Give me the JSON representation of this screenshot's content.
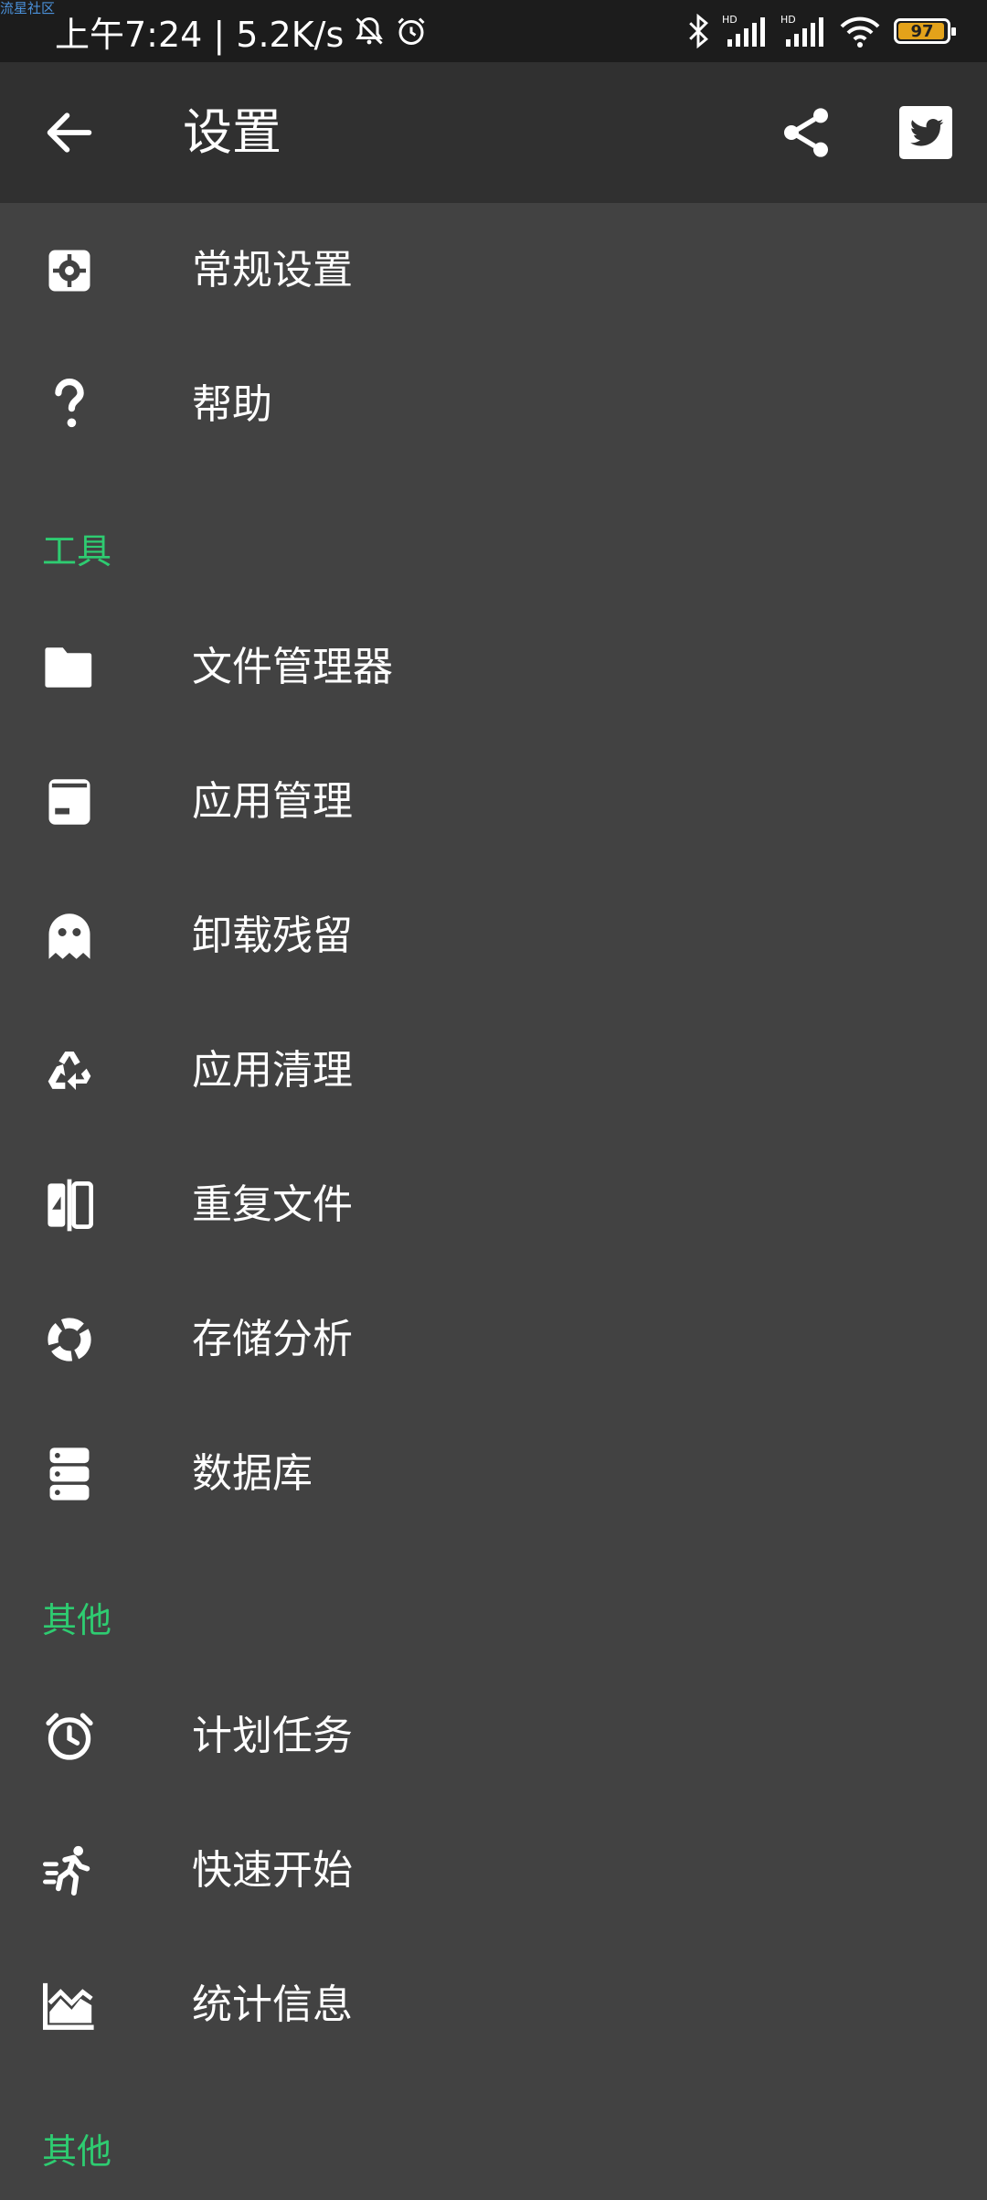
{
  "statusbar": {
    "watermark": "流星社区",
    "time_text": "上午7:24 | 5.2K/s",
    "battery": "97",
    "battery_level": 0.97
  },
  "appbar": {
    "title": "设置"
  },
  "items": {
    "general": "常规设置",
    "help": "帮助",
    "file_manager": "文件管理器",
    "app_manager": "应用管理",
    "leftovers": "卸载残留",
    "app_cleaner": "应用清理",
    "duplicates": "重复文件",
    "storage": "存储分析",
    "database": "数据库",
    "scheduled": "计划任务",
    "quick_start": "快速开始",
    "statistics": "统计信息"
  },
  "sections": {
    "tools": "工具",
    "other1": "其他",
    "other2": "其他"
  },
  "colors": {
    "section_accent": "#2ecc71",
    "background": "#424242",
    "appbar": "#303030",
    "statusbar": "#1c1c1c"
  }
}
